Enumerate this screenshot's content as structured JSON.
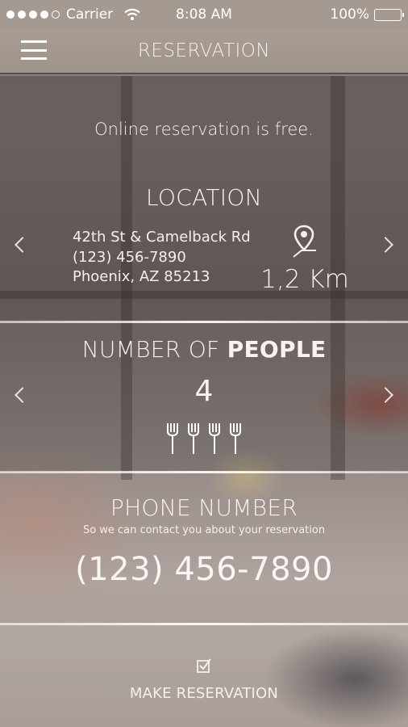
{
  "status_bar": {
    "carrier": "Carrier",
    "time": "8:08 AM",
    "battery": "100%",
    "signal_filled": 4,
    "signal_total": 5,
    "battery_level": 1.0
  },
  "nav": {
    "title": "RESERVATION",
    "menu_icon": "hamburger-menu-icon"
  },
  "intro": "Online reservation is free.",
  "location": {
    "heading": "LOCATION",
    "address_line1": "42th St & Camelback Rd",
    "address_line2": "(123) 456-7890",
    "address_line3": "Phoenix, AZ 85213",
    "distance": "1,2 Km",
    "pin_icon": "map-pin-icon"
  },
  "people": {
    "heading_plain": "NUMBER OF ",
    "heading_bold": "PEOPLE",
    "count": "4",
    "fork_count": 4
  },
  "phone": {
    "heading_plain": "PHONE ",
    "heading_rest": "NUMBER",
    "subtitle": "So we can contact you about your reservation",
    "number": "(123) 456-7890"
  },
  "action": {
    "label": "MAKE RESERVATION",
    "icon": "checkbox-checked-icon"
  },
  "colors": {
    "text": "#ffffff",
    "navbar": "#a59a91",
    "divider": "#ffffff"
  }
}
